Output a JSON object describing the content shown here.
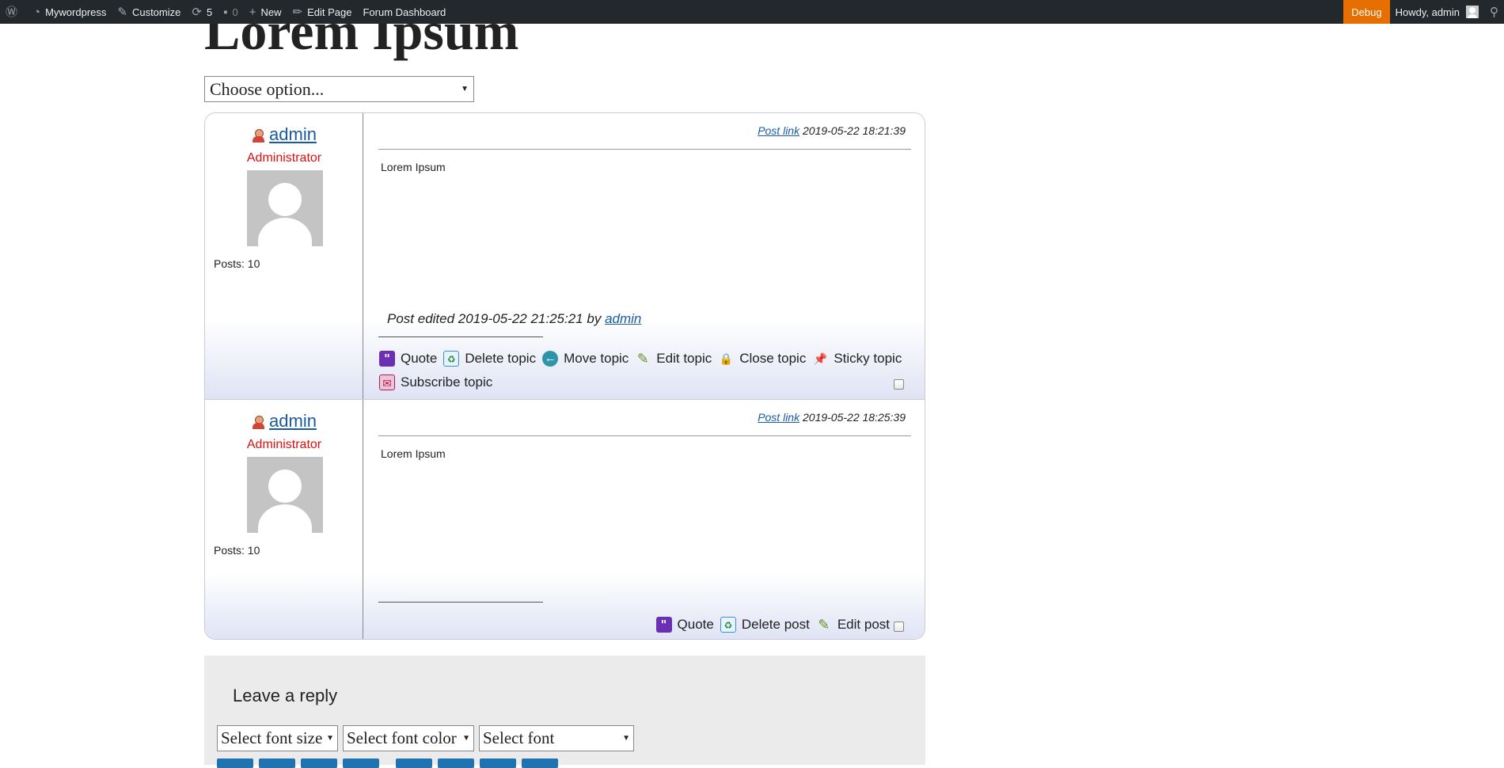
{
  "adminbar": {
    "site_name": "Mywordpress",
    "customize": "Customize",
    "updates_count": "5",
    "comments_count": "0",
    "new": "New",
    "edit_page": "Edit Page",
    "forum_dashboard": "Forum Dashboard",
    "debug": "Debug",
    "howdy": "Howdy, admin"
  },
  "page": {
    "title": "Lorem Ipsum",
    "choose_option": "Choose option..."
  },
  "posts": [
    {
      "author": "admin",
      "role": "Administrator",
      "posts_label": "Posts: 10",
      "post_link": "Post link",
      "datetime": "2019-05-22 18:21:39",
      "body": "Lorem Ipsum",
      "edited_prefix": "Post edited 2019-05-22 21:25:21 by",
      "edited_by": "admin",
      "actions": {
        "quote": "Quote",
        "delete": "Delete topic",
        "move": "Move topic",
        "edit": "Edit topic",
        "close": "Close topic",
        "sticky": "Sticky topic",
        "subscribe": "Subscribe topic"
      }
    },
    {
      "author": "admin",
      "role": "Administrator",
      "posts_label": "Posts: 10",
      "post_link": "Post link",
      "datetime": "2019-05-22 18:25:39",
      "body": "Lorem Ipsum",
      "actions": {
        "quote": "Quote",
        "delete": "Delete post",
        "edit": "Edit post"
      }
    }
  ],
  "reply": {
    "title": "Leave a reply",
    "font_size": "Select font size",
    "font_color": "Select font color",
    "font": "Select font"
  }
}
